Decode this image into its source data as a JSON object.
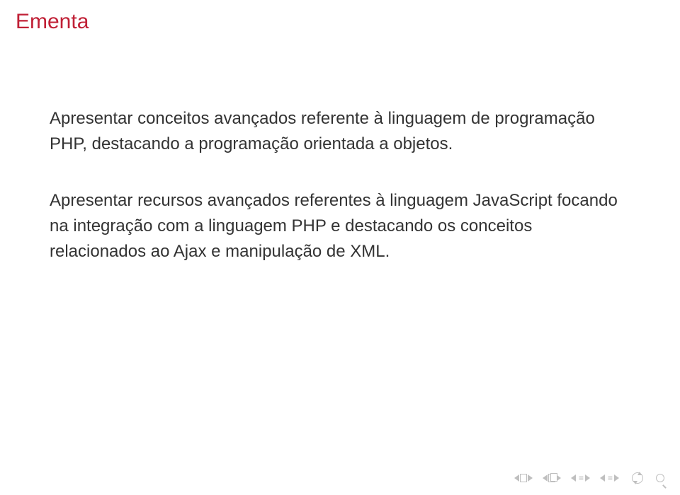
{
  "title": "Ementa",
  "paragraphs": [
    "Apresentar conceitos avançados referente à linguagem de programação PHP, destacando a programação orientada a objetos.",
    "Apresentar recursos avançados referentes à linguagem JavaScript focando na integração com a linguagem PHP e destacando os conceitos relacionados ao Ajax e manipulação de XML."
  ],
  "nav": {
    "bars1": "≡",
    "bars2": "≡"
  }
}
